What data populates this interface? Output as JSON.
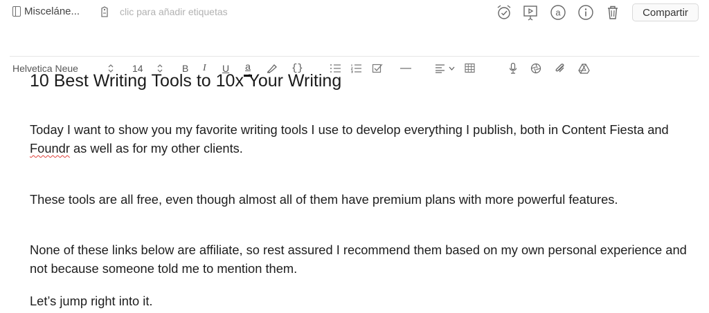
{
  "topbar": {
    "notebook": "Misceláne...",
    "tag_placeholder": "clic para añadir etiquetas",
    "icons": [
      "alarm-clock-icon",
      "presentation-icon",
      "mention-icon",
      "info-icon",
      "trash-icon"
    ],
    "share_label": "Compartir"
  },
  "toolbar": {
    "font_name": "Helvetica Neue",
    "font_size": "14",
    "bold": "B",
    "italic": "I",
    "underline": "U",
    "text_color": "a",
    "code": "{}",
    "accent_color": "#000000"
  },
  "document": {
    "title": "10 Best Writing Tools to 10x Your Writing",
    "p1_before": "Today I want to show you my favorite writing tools I use to develop everything I publish, both in Content Fiesta and ",
    "p1_misspelled": "Foundr",
    "p1_after": " as well as for my other clients.",
    "p2": "These tools are all free, even though almost all of them have premium plans with more powerful features.",
    "p3": "None of these links below are affiliate, so rest assured I recommend them based on my own personal experience and not because someone told me to mention them.",
    "p4": "Let’s jump right into it."
  }
}
